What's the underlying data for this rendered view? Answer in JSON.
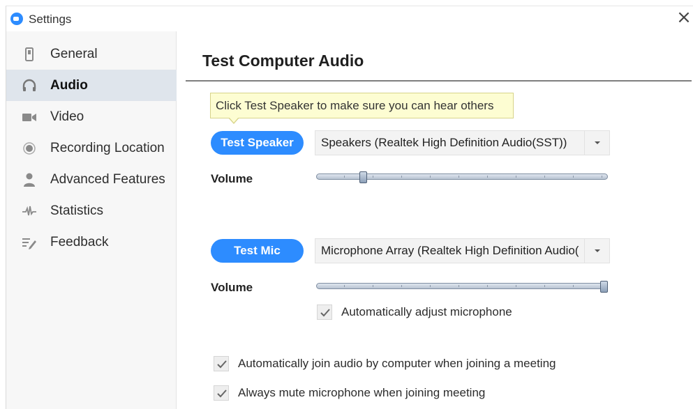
{
  "window": {
    "title": "Settings",
    "close_glyph": "×"
  },
  "sidebar": {
    "items": [
      {
        "label": "General",
        "icon": "phone-icon",
        "active": false
      },
      {
        "label": "Audio",
        "icon": "headphones-icon",
        "active": true
      },
      {
        "label": "Video",
        "icon": "video-camera-icon",
        "active": false
      },
      {
        "label": "Recording Location",
        "icon": "record-dot-icon",
        "active": false
      },
      {
        "label": "Advanced Features",
        "icon": "person-icon",
        "active": false
      },
      {
        "label": "Statistics",
        "icon": "waveform-icon",
        "active": false
      },
      {
        "label": "Feedback",
        "icon": "feedback-edit-icon",
        "active": false
      }
    ]
  },
  "main": {
    "heading": "Test Computer Audio",
    "tooltip": "Click Test Speaker to make sure you can hear others",
    "speaker": {
      "button_label": "Test Speaker",
      "device": "Speakers (Realtek High Definition Audio(SST))",
      "volume_label": "Volume",
      "volume_fraction": 0.16
    },
    "mic": {
      "button_label": "Test Mic",
      "device": "Microphone Array (Realtek High Definition Audio(SST))",
      "volume_label": "Volume",
      "volume_fraction": 1.0,
      "auto_adjust_label": "Automatically adjust microphone",
      "auto_adjust_checked": true
    },
    "options": [
      {
        "label": "Automatically join audio by computer when joining a meeting",
        "checked": true
      },
      {
        "label": "Always mute microphone when joining meeting",
        "checked": true
      }
    ]
  },
  "colors": {
    "accent": "#2d8cff",
    "active_nav_bg": "#dfe5ec",
    "tooltip_bg": "#fdfdd2"
  }
}
